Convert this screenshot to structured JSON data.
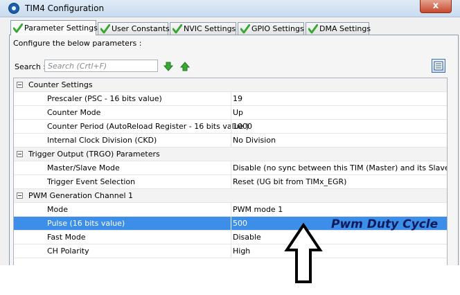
{
  "window": {
    "title": "TIM4 Configuration",
    "close_label": "x"
  },
  "tabs": [
    {
      "label": "Parameter Settings",
      "active": true
    },
    {
      "label": "User Constants",
      "active": false
    },
    {
      "label": "NVIC Settings",
      "active": false
    },
    {
      "label": "GPIO Settings",
      "active": false
    },
    {
      "label": "DMA Settings",
      "active": false
    }
  ],
  "instructions": "Configure the below parameters :",
  "search": {
    "label": "Search :",
    "placeholder": "Search (Crtl+F)"
  },
  "groups": [
    {
      "label": "Counter Settings",
      "params": [
        {
          "name": "Prescaler (PSC - 16 bits value)",
          "value": "19"
        },
        {
          "name": "Counter Mode",
          "value": "Up"
        },
        {
          "name": "Counter Period (AutoReload Register - 16 bits value )",
          "value": "1000"
        },
        {
          "name": "Internal Clock Division (CKD)",
          "value": "No Division"
        }
      ]
    },
    {
      "label": "Trigger Output (TRGO) Parameters",
      "params": [
        {
          "name": "Master/Slave Mode",
          "value": "Disable (no sync between this TIM (Master) and its Slaves"
        },
        {
          "name": "Trigger Event Selection",
          "value": "Reset (UG bit from TIMx_EGR)"
        }
      ]
    },
    {
      "label": "PWM Generation Channel 1",
      "params": [
        {
          "name": "Mode",
          "value": "PWM mode 1"
        },
        {
          "name": "Pulse (16 bits value)",
          "value": "500",
          "selected": true
        },
        {
          "name": "Fast Mode",
          "value": "Disable"
        },
        {
          "name": "CH Polarity",
          "value": "High"
        }
      ]
    }
  ],
  "annotation": {
    "label": "Pwm Duty Cycle"
  },
  "colors": {
    "selected_row": "#3d8ee8",
    "check_green": "#3aa635",
    "annotation_text": "#0d1a5c"
  }
}
